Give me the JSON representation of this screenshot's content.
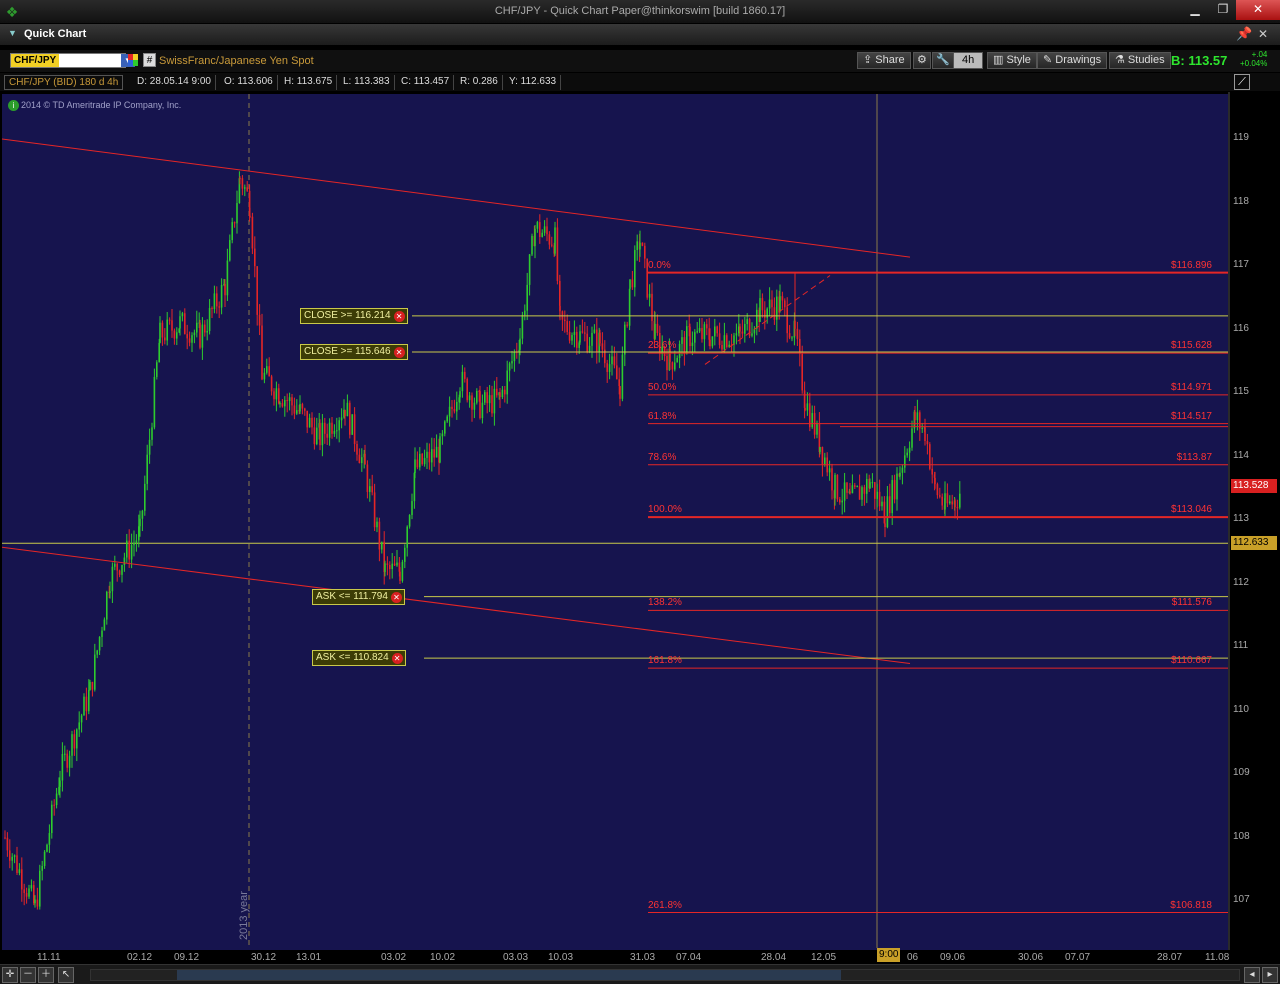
{
  "window": {
    "title": "CHF/JPY - Quick Chart Paper@thinkorswim [build 1860.17]",
    "min": "▁",
    "max": "❐",
    "close": "✕"
  },
  "panel": {
    "label": "Quick Chart",
    "pin": "📌",
    "close": "✕"
  },
  "toolbar": {
    "symbol": "CHF/JPY",
    "description": "SwissFranc/Japanese Yen Spot",
    "hash": "#",
    "share": "Share",
    "period": "4h",
    "style": "Style",
    "drawings": "Drawings",
    "studies": "Studies",
    "bid": "B: 113.57",
    "change_abs": "+.04",
    "change_pct": "+0.04%"
  },
  "infobar": {
    "symbol": "CHF/JPY (BID) 180 d 4h",
    "date": "D: 28.05.14 9:00",
    "open": "O: 113.606",
    "high": "H: 113.675",
    "low": "L: 113.383",
    "close": "C: 113.457",
    "range": "R: 0.286",
    "y": "Y: 112.633"
  },
  "copyright": "2014 © TD Ameritrade IP Company, Inc.",
  "orders": [
    {
      "label": "CLOSE >= 116.214",
      "price": 116.214
    },
    {
      "label": "CLOSE >= 115.646",
      "price": 115.646
    },
    {
      "label": "ASK <= 111.794",
      "price": 111.794
    },
    {
      "label": "ASK <= 110.824",
      "price": 110.824
    }
  ],
  "price_tags": {
    "current": "113.528",
    "cursor": "112.633",
    "current_color": "#d82020",
    "cursor_color": "#c9a028"
  },
  "fib": [
    {
      "level": "0.0%",
      "price_text": "$116.896",
      "price": 116.896
    },
    {
      "level": "23.6%",
      "price_text": "$115.628",
      "price": 115.628
    },
    {
      "level": "50.0%",
      "price_text": "$114.971",
      "price": 114.971
    },
    {
      "level": "61.8%",
      "price_text": "$114.517",
      "price": 114.517
    },
    {
      "level": "78.6%",
      "price_text": "$113.87",
      "price": 113.87
    },
    {
      "level": "100.0%",
      "price_text": "$113.046",
      "price": 113.046
    },
    {
      "level": "138.2%",
      "price_text": "$111.576",
      "price": 111.576
    },
    {
      "level": "161.8%",
      "price_text": "$110.667",
      "price": 110.667
    },
    {
      "level": "261.8%",
      "price_text": "$106.818",
      "price": 106.818
    }
  ],
  "y_axis": [
    "119",
    "118",
    "117",
    "116",
    "115",
    "114",
    "113",
    "112",
    "111",
    "110",
    "109",
    "108",
    "107"
  ],
  "x_axis": [
    "11.11",
    "02.12",
    "09.12",
    "30.12",
    "13.01",
    "03.02",
    "10.02",
    "03.03",
    "10.03",
    "31.03",
    "07.04",
    "28.04",
    "12.05",
    "06",
    "09.06",
    "30.06",
    "07.07",
    "28.07",
    "11.08"
  ],
  "time_cursor": "9:00",
  "year_label": "2013 year",
  "colors": {
    "chart_bg": "#16144e",
    "up": "#2ecc2e",
    "down": "#e52626",
    "trend": "#e52626",
    "order_line": "#c9c94a",
    "fib": "#e52626"
  }
}
